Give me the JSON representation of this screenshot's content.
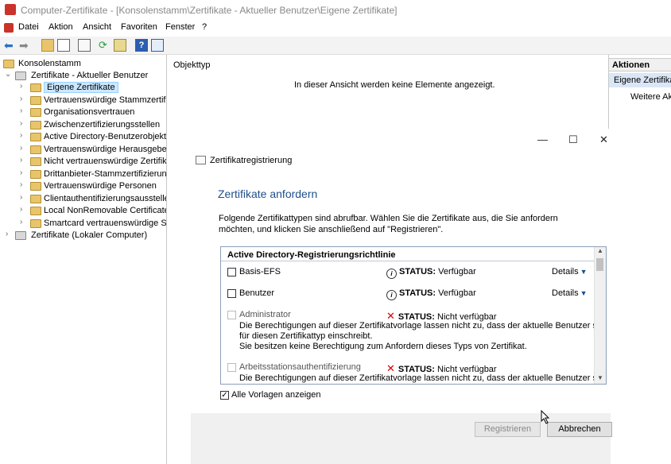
{
  "window": {
    "title": "Computer-Zertifikate - [Konsolenstamm\\Zertifikate - Aktueller Benutzer\\Eigene Zertifikate]"
  },
  "menu": [
    "Datei",
    "Aktion",
    "Ansicht",
    "Favoriten",
    "Fenster",
    "?"
  ],
  "toolbar": [
    "back-icon",
    "forward-icon",
    "up-icon",
    "show-hide-tree-icon",
    "copy-icon",
    "refresh-icon",
    "export-icon",
    "help-icon",
    "properties-icon"
  ],
  "tree": {
    "root": "Konsolenstamm",
    "user_store": "Zertifikate - Aktueller Benutzer",
    "children": [
      "Eigene Zertifikate",
      "Vertrauenswürdige Stammzertifi",
      "Organisationsvertrauen",
      "Zwischenzertifizierungsstellen",
      "Active Directory-Benutzerobjekt",
      "Vertrauenswürdige Herausgeber",
      "Nicht vertrauenswürdige Zertifika",
      "Drittanbieter-Stammzertifizierung",
      "Vertrauenswürdige Personen",
      "Clientauthentifizierungsaussteller",
      "Local NonRemovable Certificates",
      "Smartcard vertrauenswürdige Stäı"
    ],
    "computer_store": "Zertifikate (Lokaler Computer)"
  },
  "middle": {
    "column_header": "Objekttyp",
    "empty_message": "In dieser Ansicht werden keine Elemente angezeigt."
  },
  "actions": {
    "header": "Aktionen",
    "item1": "Eigene Zertifikate",
    "item2": "Weitere Akt"
  },
  "dialog": {
    "window_controls": {
      "minimize": "—",
      "maximize": "☐",
      "close": "✕"
    },
    "title": "Zertifikatregistrierung",
    "heading": "Zertifikate anfordern",
    "description": "Folgende Zertifikattypen sind abrufbar. Wählen Sie die Zertifikate aus, die Sie anfordern möchten, und klicken Sie anschließend auf \"Registrieren\".",
    "list_header": "Active Directory-Registrierungsrichtlinie",
    "status_label": "STATUS:",
    "details_label": "Details",
    "items": [
      {
        "name": "Basis-EFS",
        "status": "Verfügbar"
      },
      {
        "name": "Benutzer",
        "status": "Verfügbar"
      },
      {
        "name": "Administrator",
        "status": "Nicht verfügbar",
        "desc1": "Die Berechtigungen auf dieser Zertifikatvorlage lassen nicht zu, dass der aktuelle Benutzer sich",
        "desc2": "für diesen Zertifikattyp einschreibt.",
        "desc3": "Sie besitzen keine Berechtigung zum Anfordern dieses Typs von Zertifikat."
      },
      {
        "name": "Arbeitsstationsauthentifizierung",
        "status": "Nicht verfügbar",
        "desc1": "Die Berechtigungen auf dieser Zertifikatvorlage lassen nicht zu, dass der aktuelle Benutzer sich"
      }
    ],
    "show_all_label": "Alle Vorlagen anzeigen",
    "show_all_checked": true,
    "register_button": "Registrieren",
    "cancel_button": "Abbrechen"
  },
  "colors": {
    "heading": "#1e4e8c",
    "selection": "#cce8ff",
    "error": "#d00000",
    "folder": "#e8c56b"
  }
}
